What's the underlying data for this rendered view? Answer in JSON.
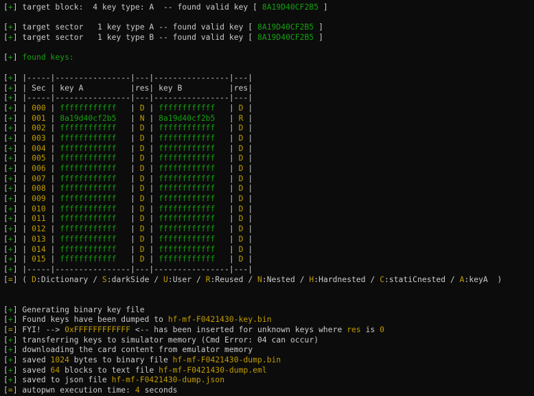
{
  "lines": [
    [
      [
        "[",
        "w"
      ],
      [
        "+",
        "g"
      ],
      [
        "] target block:  4 key type: A  -- found valid key [ ",
        "w"
      ],
      [
        "8A19D40CF2B5",
        "g"
      ],
      [
        " ]",
        "w"
      ]
    ],
    [],
    [
      [
        "[",
        "w"
      ],
      [
        "+",
        "g"
      ],
      [
        "] target sector   1 key type A -- found valid key [ ",
        "w"
      ],
      [
        "8A19D40CF2B5",
        "g"
      ],
      [
        " ]",
        "w"
      ]
    ],
    [
      [
        "[",
        "w"
      ],
      [
        "+",
        "g"
      ],
      [
        "] target sector   1 key type B -- found valid key [ ",
        "w"
      ],
      [
        "8A19D40CF2B5",
        "g"
      ],
      [
        " ]",
        "w"
      ]
    ],
    [],
    [
      [
        "[",
        "w"
      ],
      [
        "+",
        "g"
      ],
      [
        "] ",
        "w"
      ],
      [
        "found keys:",
        "g"
      ]
    ],
    [],
    [
      [
        "[",
        "w"
      ],
      [
        "+",
        "g"
      ],
      [
        "] |-----|----------------|---|----------------|---|",
        "w"
      ]
    ],
    [
      [
        "[",
        "w"
      ],
      [
        "+",
        "g"
      ],
      [
        "] | Sec | key A          |res| key B          |res|",
        "w"
      ]
    ],
    [
      [
        "[",
        "w"
      ],
      [
        "+",
        "g"
      ],
      [
        "] |-----|----------------|---|----------------|---|",
        "w"
      ]
    ],
    [
      [
        "[",
        "w"
      ],
      [
        "+",
        "g"
      ],
      [
        "] | ",
        "w"
      ],
      [
        "000",
        "y"
      ],
      [
        " | ",
        "w"
      ],
      [
        "ffffffffffff",
        "g"
      ],
      [
        "   | ",
        "w"
      ],
      [
        "D",
        "y"
      ],
      [
        " | ",
        "w"
      ],
      [
        "ffffffffffff",
        "g"
      ],
      [
        "   | ",
        "w"
      ],
      [
        "D",
        "y"
      ],
      [
        " |",
        "w"
      ]
    ],
    [
      [
        "[",
        "w"
      ],
      [
        "+",
        "g"
      ],
      [
        "] | ",
        "w"
      ],
      [
        "001",
        "y"
      ],
      [
        " | ",
        "w"
      ],
      [
        "8a19d40cf2b5",
        "g"
      ],
      [
        "   | ",
        "w"
      ],
      [
        "N",
        "y"
      ],
      [
        " | ",
        "w"
      ],
      [
        "8a19d40cf2b5",
        "g"
      ],
      [
        "   | ",
        "w"
      ],
      [
        "R",
        "y"
      ],
      [
        " |",
        "w"
      ]
    ],
    [
      [
        "[",
        "w"
      ],
      [
        "+",
        "g"
      ],
      [
        "] | ",
        "w"
      ],
      [
        "002",
        "y"
      ],
      [
        " | ",
        "w"
      ],
      [
        "ffffffffffff",
        "g"
      ],
      [
        "   | ",
        "w"
      ],
      [
        "D",
        "y"
      ],
      [
        " | ",
        "w"
      ],
      [
        "ffffffffffff",
        "g"
      ],
      [
        "   | ",
        "w"
      ],
      [
        "D",
        "y"
      ],
      [
        " |",
        "w"
      ]
    ],
    [
      [
        "[",
        "w"
      ],
      [
        "+",
        "g"
      ],
      [
        "] | ",
        "w"
      ],
      [
        "003",
        "y"
      ],
      [
        " | ",
        "w"
      ],
      [
        "ffffffffffff",
        "g"
      ],
      [
        "   | ",
        "w"
      ],
      [
        "D",
        "y"
      ],
      [
        " | ",
        "w"
      ],
      [
        "ffffffffffff",
        "g"
      ],
      [
        "   | ",
        "w"
      ],
      [
        "D",
        "y"
      ],
      [
        " |",
        "w"
      ]
    ],
    [
      [
        "[",
        "w"
      ],
      [
        "+",
        "g"
      ],
      [
        "] | ",
        "w"
      ],
      [
        "004",
        "y"
      ],
      [
        " | ",
        "w"
      ],
      [
        "ffffffffffff",
        "g"
      ],
      [
        "   | ",
        "w"
      ],
      [
        "D",
        "y"
      ],
      [
        " | ",
        "w"
      ],
      [
        "ffffffffffff",
        "g"
      ],
      [
        "   | ",
        "w"
      ],
      [
        "D",
        "y"
      ],
      [
        " |",
        "w"
      ]
    ],
    [
      [
        "[",
        "w"
      ],
      [
        "+",
        "g"
      ],
      [
        "] | ",
        "w"
      ],
      [
        "005",
        "y"
      ],
      [
        " | ",
        "w"
      ],
      [
        "ffffffffffff",
        "g"
      ],
      [
        "   | ",
        "w"
      ],
      [
        "D",
        "y"
      ],
      [
        " | ",
        "w"
      ],
      [
        "ffffffffffff",
        "g"
      ],
      [
        "   | ",
        "w"
      ],
      [
        "D",
        "y"
      ],
      [
        " |",
        "w"
      ]
    ],
    [
      [
        "[",
        "w"
      ],
      [
        "+",
        "g"
      ],
      [
        "] | ",
        "w"
      ],
      [
        "006",
        "y"
      ],
      [
        " | ",
        "w"
      ],
      [
        "ffffffffffff",
        "g"
      ],
      [
        "   | ",
        "w"
      ],
      [
        "D",
        "y"
      ],
      [
        " | ",
        "w"
      ],
      [
        "ffffffffffff",
        "g"
      ],
      [
        "   | ",
        "w"
      ],
      [
        "D",
        "y"
      ],
      [
        " |",
        "w"
      ]
    ],
    [
      [
        "[",
        "w"
      ],
      [
        "+",
        "g"
      ],
      [
        "] | ",
        "w"
      ],
      [
        "007",
        "y"
      ],
      [
        " | ",
        "w"
      ],
      [
        "ffffffffffff",
        "g"
      ],
      [
        "   | ",
        "w"
      ],
      [
        "D",
        "y"
      ],
      [
        " | ",
        "w"
      ],
      [
        "ffffffffffff",
        "g"
      ],
      [
        "   | ",
        "w"
      ],
      [
        "D",
        "y"
      ],
      [
        " |",
        "w"
      ]
    ],
    [
      [
        "[",
        "w"
      ],
      [
        "+",
        "g"
      ],
      [
        "] | ",
        "w"
      ],
      [
        "008",
        "y"
      ],
      [
        " | ",
        "w"
      ],
      [
        "ffffffffffff",
        "g"
      ],
      [
        "   | ",
        "w"
      ],
      [
        "D",
        "y"
      ],
      [
        " | ",
        "w"
      ],
      [
        "ffffffffffff",
        "g"
      ],
      [
        "   | ",
        "w"
      ],
      [
        "D",
        "y"
      ],
      [
        " |",
        "w"
      ]
    ],
    [
      [
        "[",
        "w"
      ],
      [
        "+",
        "g"
      ],
      [
        "] | ",
        "w"
      ],
      [
        "009",
        "y"
      ],
      [
        " | ",
        "w"
      ],
      [
        "ffffffffffff",
        "g"
      ],
      [
        "   | ",
        "w"
      ],
      [
        "D",
        "y"
      ],
      [
        " | ",
        "w"
      ],
      [
        "ffffffffffff",
        "g"
      ],
      [
        "   | ",
        "w"
      ],
      [
        "D",
        "y"
      ],
      [
        " |",
        "w"
      ]
    ],
    [
      [
        "[",
        "w"
      ],
      [
        "+",
        "g"
      ],
      [
        "] | ",
        "w"
      ],
      [
        "010",
        "y"
      ],
      [
        " | ",
        "w"
      ],
      [
        "ffffffffffff",
        "g"
      ],
      [
        "   | ",
        "w"
      ],
      [
        "D",
        "y"
      ],
      [
        " | ",
        "w"
      ],
      [
        "ffffffffffff",
        "g"
      ],
      [
        "   | ",
        "w"
      ],
      [
        "D",
        "y"
      ],
      [
        " |",
        "w"
      ]
    ],
    [
      [
        "[",
        "w"
      ],
      [
        "+",
        "g"
      ],
      [
        "] | ",
        "w"
      ],
      [
        "011",
        "y"
      ],
      [
        " | ",
        "w"
      ],
      [
        "ffffffffffff",
        "g"
      ],
      [
        "   | ",
        "w"
      ],
      [
        "D",
        "y"
      ],
      [
        " | ",
        "w"
      ],
      [
        "ffffffffffff",
        "g"
      ],
      [
        "   | ",
        "w"
      ],
      [
        "D",
        "y"
      ],
      [
        " |",
        "w"
      ]
    ],
    [
      [
        "[",
        "w"
      ],
      [
        "+",
        "g"
      ],
      [
        "] | ",
        "w"
      ],
      [
        "012",
        "y"
      ],
      [
        " | ",
        "w"
      ],
      [
        "ffffffffffff",
        "g"
      ],
      [
        "   | ",
        "w"
      ],
      [
        "D",
        "y"
      ],
      [
        " | ",
        "w"
      ],
      [
        "ffffffffffff",
        "g"
      ],
      [
        "   | ",
        "w"
      ],
      [
        "D",
        "y"
      ],
      [
        " |",
        "w"
      ]
    ],
    [
      [
        "[",
        "w"
      ],
      [
        "+",
        "g"
      ],
      [
        "] | ",
        "w"
      ],
      [
        "013",
        "y"
      ],
      [
        " | ",
        "w"
      ],
      [
        "ffffffffffff",
        "g"
      ],
      [
        "   | ",
        "w"
      ],
      [
        "D",
        "y"
      ],
      [
        " | ",
        "w"
      ],
      [
        "ffffffffffff",
        "g"
      ],
      [
        "   | ",
        "w"
      ],
      [
        "D",
        "y"
      ],
      [
        " |",
        "w"
      ]
    ],
    [
      [
        "[",
        "w"
      ],
      [
        "+",
        "g"
      ],
      [
        "] | ",
        "w"
      ],
      [
        "014",
        "y"
      ],
      [
        " | ",
        "w"
      ],
      [
        "ffffffffffff",
        "g"
      ],
      [
        "   | ",
        "w"
      ],
      [
        "D",
        "y"
      ],
      [
        " | ",
        "w"
      ],
      [
        "ffffffffffff",
        "g"
      ],
      [
        "   | ",
        "w"
      ],
      [
        "D",
        "y"
      ],
      [
        " |",
        "w"
      ]
    ],
    [
      [
        "[",
        "w"
      ],
      [
        "+",
        "g"
      ],
      [
        "] | ",
        "w"
      ],
      [
        "015",
        "y"
      ],
      [
        " | ",
        "w"
      ],
      [
        "ffffffffffff",
        "g"
      ],
      [
        "   | ",
        "w"
      ],
      [
        "D",
        "y"
      ],
      [
        " | ",
        "w"
      ],
      [
        "ffffffffffff",
        "g"
      ],
      [
        "   | ",
        "w"
      ],
      [
        "D",
        "y"
      ],
      [
        " |",
        "w"
      ]
    ],
    [
      [
        "[",
        "w"
      ],
      [
        "+",
        "g"
      ],
      [
        "] |-----|----------------|---|----------------|---|",
        "w"
      ]
    ],
    [
      [
        "[",
        "w"
      ],
      [
        "=",
        "y"
      ],
      [
        "] ( ",
        "w"
      ],
      [
        "D",
        "y"
      ],
      [
        ":Dictionary / ",
        "w"
      ],
      [
        "S",
        "y"
      ],
      [
        ":darkSide / ",
        "w"
      ],
      [
        "U",
        "y"
      ],
      [
        ":User / ",
        "w"
      ],
      [
        "R",
        "y"
      ],
      [
        ":Reused / ",
        "w"
      ],
      [
        "N",
        "y"
      ],
      [
        ":Nested / ",
        "w"
      ],
      [
        "H",
        "y"
      ],
      [
        ":Hardnested / ",
        "w"
      ],
      [
        "C",
        "y"
      ],
      [
        ":statiCnested / ",
        "w"
      ],
      [
        "A",
        "y"
      ],
      [
        ":keyA  )",
        "w"
      ]
    ],
    [],
    [],
    [
      [
        "[",
        "w"
      ],
      [
        "+",
        "g"
      ],
      [
        "] Generating binary key file",
        "w"
      ]
    ],
    [
      [
        "[",
        "w"
      ],
      [
        "+",
        "g"
      ],
      [
        "] Found keys have been dumped to ",
        "w"
      ],
      [
        "hf-mf-F0421430-key.bin",
        "y"
      ]
    ],
    [
      [
        "[",
        "w"
      ],
      [
        "=",
        "y"
      ],
      [
        "] FYI! --> ",
        "w"
      ],
      [
        "0xFFFFFFFFFFFF",
        "y"
      ],
      [
        " <-- has been inserted for unknown keys where ",
        "w"
      ],
      [
        "res",
        "y"
      ],
      [
        " is ",
        "w"
      ],
      [
        "0",
        "y"
      ]
    ],
    [
      [
        "[",
        "w"
      ],
      [
        "+",
        "g"
      ],
      [
        "] transferring keys to simulator memory (Cmd Error: 04 can occur)",
        "w"
      ]
    ],
    [
      [
        "[",
        "w"
      ],
      [
        "+",
        "g"
      ],
      [
        "] downloading the card content from emulator memory",
        "w"
      ]
    ],
    [
      [
        "[",
        "w"
      ],
      [
        "+",
        "g"
      ],
      [
        "] saved ",
        "w"
      ],
      [
        "1024",
        "y"
      ],
      [
        " bytes to binary file ",
        "w"
      ],
      [
        "hf-mf-F0421430-dump.bin",
        "y"
      ]
    ],
    [
      [
        "[",
        "w"
      ],
      [
        "+",
        "g"
      ],
      [
        "] saved ",
        "w"
      ],
      [
        "64",
        "y"
      ],
      [
        " blocks to text file ",
        "w"
      ],
      [
        "hf-mf-F0421430-dump.eml",
        "y"
      ]
    ],
    [
      [
        "[",
        "w"
      ],
      [
        "+",
        "g"
      ],
      [
        "] saved to json file ",
        "w"
      ],
      [
        "hf-mf-F0421430-dump.json",
        "y"
      ]
    ],
    [
      [
        "[",
        "w"
      ],
      [
        "=",
        "y"
      ],
      [
        "] autopwn execution time: ",
        "w"
      ],
      [
        "4",
        "y"
      ],
      [
        " seconds",
        "w"
      ]
    ]
  ]
}
